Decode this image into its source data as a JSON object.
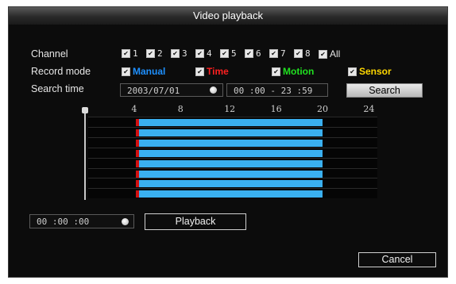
{
  "window": {
    "title": "Video playback"
  },
  "labels": {
    "channel": "Channel",
    "record_mode": "Record mode",
    "search_time": "Search time"
  },
  "channels": [
    {
      "label": "1",
      "checked": true
    },
    {
      "label": "2",
      "checked": true
    },
    {
      "label": "3",
      "checked": true
    },
    {
      "label": "4",
      "checked": true
    },
    {
      "label": "5",
      "checked": true
    },
    {
      "label": "6",
      "checked": true
    },
    {
      "label": "7",
      "checked": true
    },
    {
      "label": "8",
      "checked": true
    },
    {
      "label": "All",
      "checked": true
    }
  ],
  "record_modes": [
    {
      "label": "Manual",
      "color": "#1e90ff",
      "checked": true
    },
    {
      "label": "Time",
      "color": "#ff2020",
      "checked": true
    },
    {
      "label": "Motion",
      "color": "#20e020",
      "checked": true
    },
    {
      "label": "Sensor",
      "color": "#ffd700",
      "checked": true
    }
  ],
  "search": {
    "date": "2003/07/01",
    "time_range": "00 :00  -  23 :59",
    "button_label": "Search"
  },
  "timeline": {
    "hour_labels": [
      "4",
      "8",
      "12",
      "16",
      "20",
      "24"
    ],
    "rows": 8,
    "recording_start_hour": 4,
    "recording_end_hour": 20.1,
    "colors": {
      "recording": "#3ab0f0",
      "time_marker": "#d01010"
    }
  },
  "playback": {
    "time": "00 :00 :00",
    "button_label": "Playback"
  },
  "cancel_label": "Cancel",
  "icons": {
    "checkbox": "checkmark-icon",
    "spinner": "dot-icon"
  }
}
